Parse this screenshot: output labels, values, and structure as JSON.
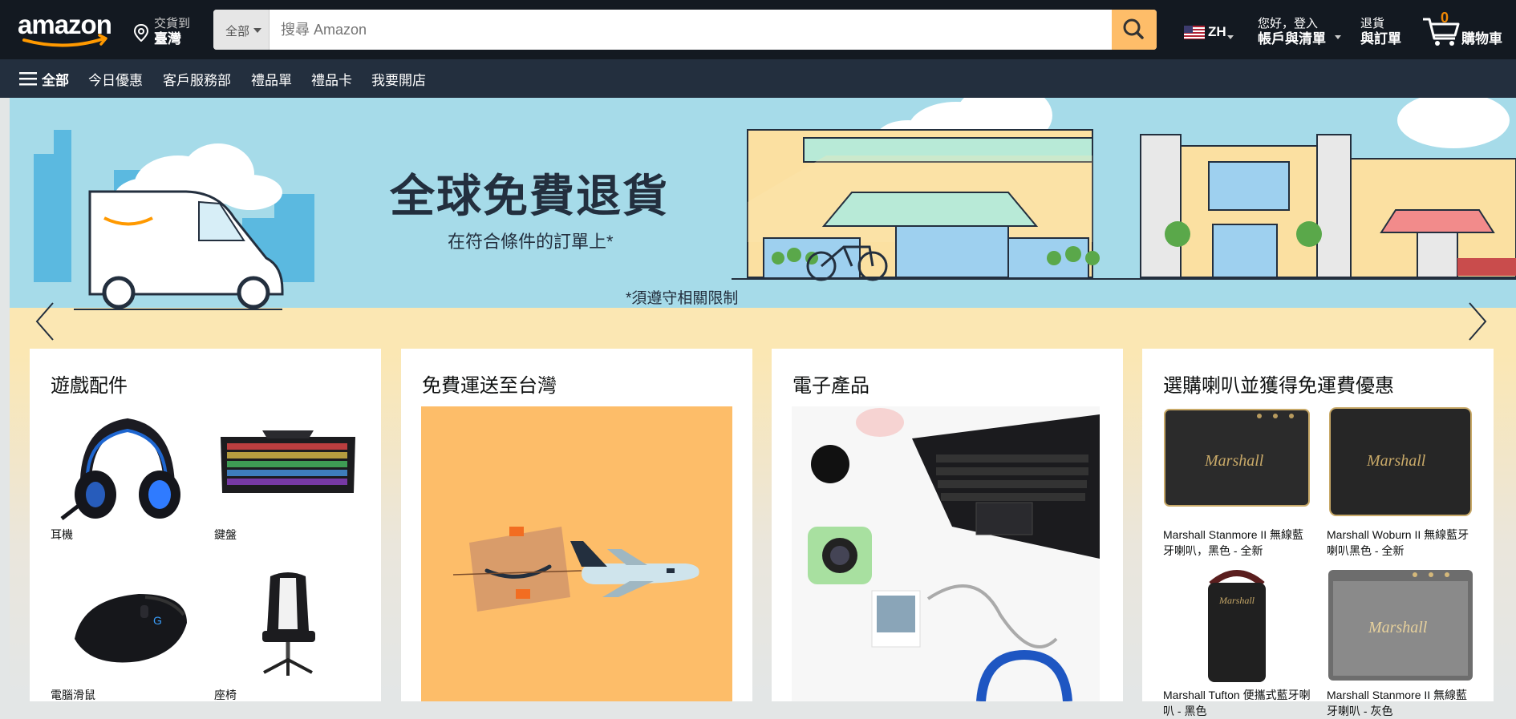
{
  "header": {
    "logo_text": "amazon",
    "deliver_line1": "交貨到",
    "deliver_line2": "臺灣",
    "search_category": "全部",
    "search_placeholder": "搜尋 Amazon",
    "language": "ZH",
    "account_line1": "您好，登入",
    "account_line2": "帳戶與清單",
    "orders_line1": "退貨",
    "orders_line2": "與訂單",
    "cart_count": "0",
    "cart_label": "購物車"
  },
  "nav": {
    "all": "全部",
    "items": [
      "今日優惠",
      "客戶服務部",
      "禮品單",
      "禮品卡",
      "我要開店"
    ]
  },
  "hero": {
    "title": "全球免費退貨",
    "subtitle": "在符合條件的訂單上*",
    "note": "*須遵守相關限制"
  },
  "cards": [
    {
      "title": "遊戲配件",
      "items": [
        {
          "caption": "耳機",
          "icon": "headset-icon"
        },
        {
          "caption": "鍵盤",
          "icon": "keyboard-icon"
        },
        {
          "caption": "電腦滑鼠",
          "icon": "mouse-icon"
        },
        {
          "caption": "座椅",
          "icon": "chair-icon"
        }
      ]
    },
    {
      "title": "免費運送至台灣"
    },
    {
      "title": "電子產品"
    },
    {
      "title": "選購喇叭並獲得免運費優惠",
      "items": [
        {
          "caption": "Marshall Stanmore II 無線藍牙喇叭，黑色 - 全新"
        },
        {
          "caption": "Marshall Woburn II 無線藍牙喇叭黑色 - 全新"
        },
        {
          "caption": "Marshall Tufton 便攜式藍牙喇叭 - 黑色"
        },
        {
          "caption": "Marshall Stanmore II 無線藍牙喇叭 - 灰色"
        }
      ]
    }
  ],
  "colors": {
    "header_bg": "#131921",
    "nav_bg": "#232f3e",
    "search_button": "#febd69",
    "cart_count": "#f08804",
    "logo_smile": "#ff9900"
  }
}
